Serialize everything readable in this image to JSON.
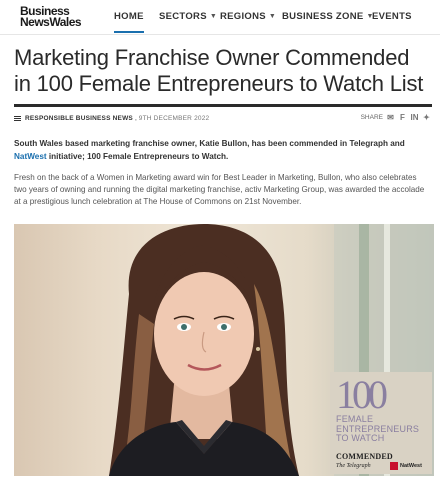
{
  "site": {
    "logo_line1": "Business",
    "logo_line2": "NewsWales"
  },
  "nav": {
    "items": [
      {
        "label": "HOME",
        "active": true
      },
      {
        "label": "SECTORS",
        "dropdown": true
      },
      {
        "label": "REGIONS",
        "dropdown": true
      },
      {
        "label": "BUSINESS ZONE",
        "dropdown": true
      },
      {
        "label": "EVENTS"
      }
    ]
  },
  "article": {
    "title": "Marketing Franchise Owner Commended in 100 Female Entrepreneurs to Watch List",
    "category": "RESPONSIBLE BUSINESS NEWS",
    "date": "9TH DECEMBER 2022",
    "share_label": "SHARE",
    "lede_part1": "South Wales based marketing franchise owner, Katie Bullon, has been commended in Telegraph and ",
    "lede_link": "NatWest",
    "lede_part2": " initiative; 100 Female Entrepreneurs to Watch.",
    "body": "Fresh on the back of a Women in Marketing award win for Best Leader in Marketing, Bullon, who also celebrates two years of owning and running the digital marketing franchise, activ Marketing Group, was awarded the accolade at a prestigious lunch celebration at The House of Commons on 21st November."
  },
  "badge": {
    "number": "100",
    "text": "FEMALE ENTREPRENEURS TO WATCH",
    "commended": "COMMENDED",
    "telegraph": "The Telegraph",
    "natwest": "NatWest"
  },
  "icons": {
    "share": [
      "email-icon",
      "facebook-icon",
      "linkedin-icon",
      "twitter-icon"
    ]
  }
}
